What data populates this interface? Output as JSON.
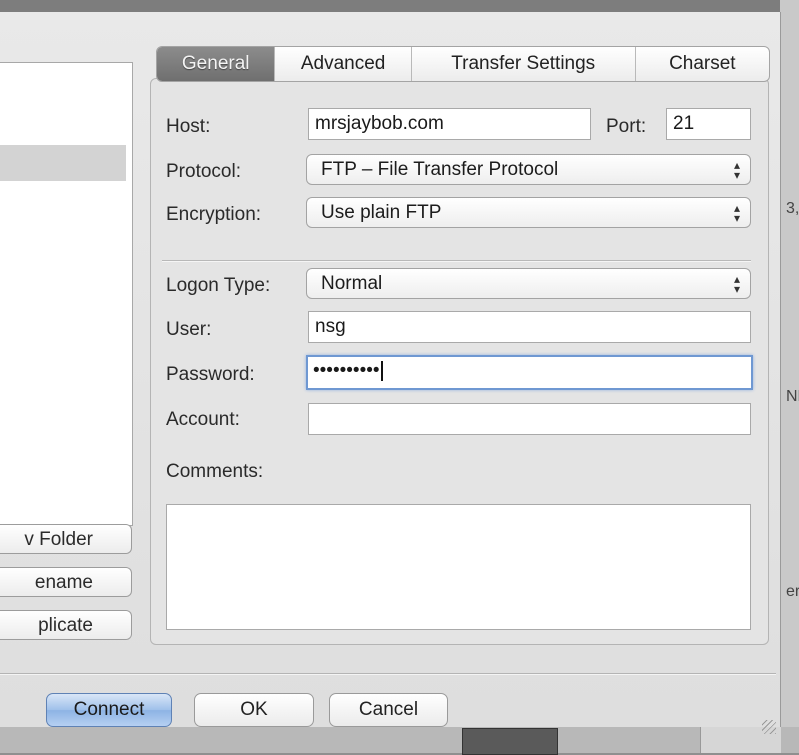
{
  "tabs": [
    {
      "label": "General",
      "active": true
    },
    {
      "label": "Advanced",
      "active": false
    },
    {
      "label": "Transfer Settings",
      "active": false
    },
    {
      "label": "Charset",
      "active": false
    }
  ],
  "form": {
    "host_label": "Host:",
    "host_value": "mrsjaybob.com",
    "port_label": "Port:",
    "port_value": "21",
    "protocol_label": "Protocol:",
    "protocol_value": "FTP – File Transfer Protocol",
    "encryption_label": "Encryption:",
    "encryption_value": "Use plain FTP",
    "logon_type_label": "Logon Type:",
    "logon_type_value": "Normal",
    "user_label": "User:",
    "user_value": "nsg",
    "password_label": "Password:",
    "password_value": "••••••••••",
    "account_label": "Account:",
    "account_value": "",
    "comments_label": "Comments:",
    "comments_value": ""
  },
  "sidebar_buttons": {
    "new_folder": "v Folder",
    "rename": "ename",
    "duplicate": "plicate"
  },
  "footer": {
    "connect": "Connect",
    "ok": "OK",
    "cancel": "Cancel"
  },
  "background_fragments": [
    "3,",
    "NF",
    "er"
  ],
  "colors": {
    "active_tab": "#7d7d7d",
    "default_button": "#9fc0ea",
    "focus_ring": "#6f98d2"
  }
}
